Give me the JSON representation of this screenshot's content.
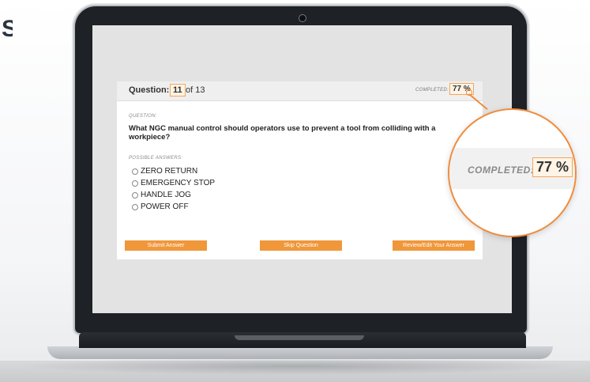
{
  "corner": {
    "glyph": "S"
  },
  "quiz": {
    "header": {
      "question_label": "Question:",
      "current_question": "11",
      "total_text": "of 13",
      "completed_label": "COMPLETED:",
      "completed_value": "77 %"
    },
    "question_section_label": "QUESTION:",
    "question_text": "What NGC manual control should operators use to prevent a tool from colliding with a workpiece?",
    "answers_section_label": "POSSIBLE ANSWERS:",
    "answers": [
      {
        "label": "ZERO RETURN"
      },
      {
        "label": "EMERGENCY STOP"
      },
      {
        "label": "HANDLE JOG"
      },
      {
        "label": "POWER OFF"
      }
    ],
    "buttons": {
      "submit": "Submit Answer",
      "skip": "Skip Question",
      "review": "Review/Edit Your Answer"
    }
  },
  "callout": {
    "completed_label": "COMPLETED:",
    "completed_value": "77 %"
  },
  "colors": {
    "accent": "#f0973a",
    "highlight_border": "#f2a75a",
    "laptop_bezel": "#1e2226"
  }
}
